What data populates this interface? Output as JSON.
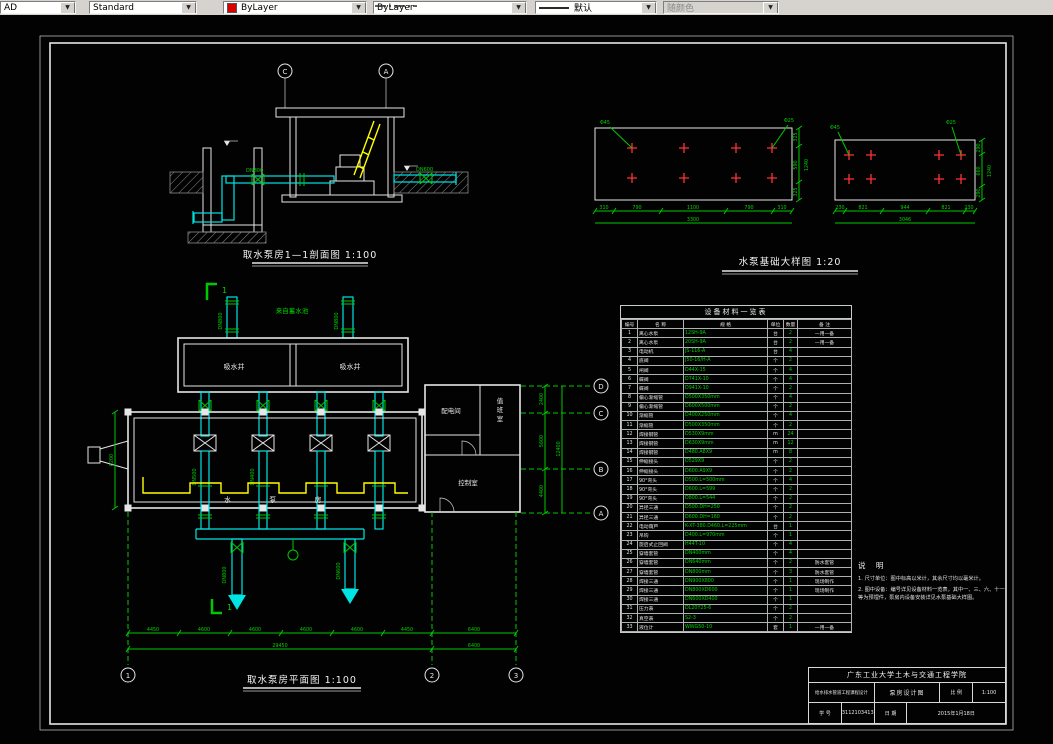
{
  "toolbar": {
    "layer_value": "AD",
    "style_value": "Standard",
    "color_value": "ByLayer",
    "linetype_value": "ByLayer",
    "lineweight_value": "默认",
    "plotstyle_value": "随颜色"
  },
  "section": {
    "title": "取水泵房1—1剖面图 1:100",
    "axis_c": "C",
    "axis_a": "A",
    "pipe_label_left": "DN800",
    "pipe_label_right": "DN600"
  },
  "foundation": {
    "title": "水泵基础大样图 1:20",
    "left": {
      "label_a": "Φ45",
      "label_b": "Φ25",
      "dims_bottom": [
        "310",
        "790",
        "1100",
        "790",
        "310"
      ],
      "dim_total": "3300",
      "dims_side": [
        "325",
        "590",
        "325"
      ],
      "dim_side_total": "1240"
    },
    "right": {
      "label_a": "Φ45",
      "label_b": "Φ25",
      "dims_bottom": [
        "230",
        "821",
        "944",
        "821",
        "230"
      ],
      "dim_total": "3046",
      "dims_side": [
        "290",
        "660",
        "290"
      ],
      "dim_side_total": "1240"
    }
  },
  "plan": {
    "title": "取水泵房平面图 1:100",
    "section_marker": "1",
    "source_label": "来自蓄水池",
    "well_label_left": "吸水井",
    "well_label_right": "吸水井",
    "hall_label": "水  泵  房",
    "room_power": "配电间",
    "room_duty": "值班室",
    "room_control": "控制室",
    "axis_letters": [
      "D",
      "C",
      "B",
      "A"
    ],
    "axis_numbers": [
      "1",
      "2",
      "3"
    ],
    "pipe_labels": {
      "inlet_left": "DN800",
      "inlet_right": "DN800",
      "riser_left": "DN500",
      "riser_right": "DN400",
      "main_left": "DN800",
      "main_right": "DN600"
    },
    "dims_bottom": [
      "4450",
      "4600",
      "4600",
      "4600",
      "4600",
      "4450",
      "6400"
    ],
    "dims_total": [
      "29450",
      "6400"
    ],
    "dims_right": [
      "2400",
      "5600",
      "4400"
    ],
    "dims_right_total": "12400",
    "dim_left": "6200"
  },
  "materials_table": {
    "title": "设备材料一览表",
    "headers": [
      "编号",
      "名  称",
      "规  格",
      "单位",
      "数量",
      "备  注"
    ],
    "rows": [
      [
        "1",
        "离心水泵",
        "12SH-9A",
        "台",
        "2",
        "一用一备"
      ],
      [
        "2",
        "离心水泵",
        "20SH-9A",
        "台",
        "2",
        "一用一备"
      ],
      [
        "3",
        "电动机",
        "JS-116-A",
        "台",
        "4",
        ""
      ],
      [
        "4",
        "底阀",
        "J50-16/H-A",
        "个",
        "2",
        ""
      ],
      [
        "5",
        "闸阀",
        "D44X-15",
        "个",
        "4",
        ""
      ],
      [
        "6",
        "蝶阀",
        "D741X-10",
        "个",
        "4",
        ""
      ],
      [
        "7",
        "蝶阀",
        "D941X-10",
        "个",
        "2",
        ""
      ],
      [
        "8",
        "偏心渐缩管",
        "D500X350mm",
        "个",
        "4",
        ""
      ],
      [
        "9",
        "偏心渐缩管",
        "D600X500mm",
        "个",
        "2",
        ""
      ],
      [
        "10",
        "渐缩管",
        "D400X250mm",
        "个",
        "4",
        ""
      ],
      [
        "11",
        "渐缩管",
        "D500X350mm",
        "个",
        "2",
        ""
      ],
      [
        "12",
        "焊接钢管",
        "D530X9mm",
        "m",
        "24",
        ""
      ],
      [
        "13",
        "焊接钢管",
        "D630X9mm",
        "m",
        "12",
        ""
      ],
      [
        "14",
        "焊接钢管",
        "D480.A8X9",
        "m",
        "8",
        ""
      ],
      [
        "15",
        "伸缩接头",
        "D529X9",
        "个",
        "2",
        ""
      ],
      [
        "16",
        "伸缩接头",
        "D600.A9X9",
        "个",
        "2",
        ""
      ],
      [
        "17",
        "90°弯头",
        "D500.L=500mm",
        "个",
        "4",
        ""
      ],
      [
        "18",
        "90°弯头",
        "D600.L=599",
        "个",
        "2",
        ""
      ],
      [
        "19",
        "90°弯头",
        "D800.L=544",
        "个",
        "2",
        ""
      ],
      [
        "20",
        "异径三通",
        "D500.DH=250",
        "个",
        "2",
        ""
      ],
      [
        "21",
        "异径三通",
        "D600.DH=160",
        "个",
        "2",
        ""
      ],
      [
        "22",
        "电动葫芦",
        "K-XT-380.D460.L=225mm",
        "台",
        "1",
        ""
      ],
      [
        "23",
        "吊钩",
        "D400.L=970mm",
        "个",
        "1",
        ""
      ],
      [
        "24",
        "旋启式止回阀",
        "H44T-10",
        "个",
        "4",
        ""
      ],
      [
        "25",
        "穿墙套管",
        "DN400mm",
        "个",
        "4",
        ""
      ],
      [
        "26",
        "穿墙套管",
        "DN640mm",
        "个",
        "2",
        "防水套管"
      ],
      [
        "27",
        "穿墙套管",
        "DN800mm",
        "个",
        "3",
        "防水套管"
      ],
      [
        "28",
        "焊接三通",
        "DN900X800",
        "个",
        "1",
        "现场制作"
      ],
      [
        "29",
        "焊接三通",
        "DN800XD600",
        "个",
        "1",
        "现场制作"
      ],
      [
        "30",
        "焊接三通",
        "DN600XD400",
        "个",
        "1",
        ""
      ],
      [
        "31",
        "压力表",
        "DL20Y25-6",
        "个",
        "2",
        ""
      ],
      [
        "32",
        "真空表",
        "S2-3",
        "个",
        "2",
        ""
      ],
      [
        "33",
        "液位计",
        "WWG50-10",
        "套",
        "1",
        "一用一备"
      ]
    ]
  },
  "notes": {
    "title": "说  明",
    "items": [
      "1. 尺寸单位：图中标高以米计，其余尺寸均以毫米计。",
      "2. 图中设备：编号详见设备材料一览表，其中一、三、六、十一等为预埋件，泵房内设备安装详见水泵基础大样图。"
    ]
  },
  "titleblock": {
    "school": "广东工业大学土木与交通工程学院",
    "course": "给水排水管道工程课程设计",
    "drawing_title": "泵房设计图",
    "scale_label": "比 例",
    "scale_value": "1:100",
    "id_label": "学 号",
    "id_value": "3112103413",
    "date_label": "日 期",
    "date_value": "2015年1月18日"
  }
}
